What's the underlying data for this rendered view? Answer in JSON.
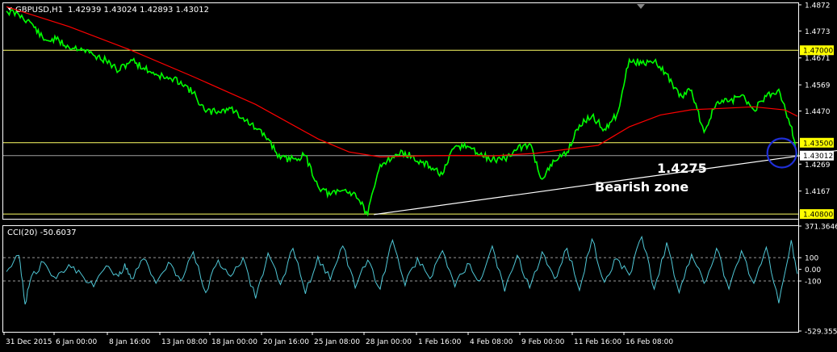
{
  "header": {
    "symbol": "GBPUSD,H1",
    "ohlc": "1.42939 1.43024 1.42893 1.43012"
  },
  "annotations": {
    "price_label": "1.4275",
    "zone_label": "Bearish zone"
  },
  "colors": {
    "background": "#000000",
    "price": "#00ff00",
    "ma": "#ff0000",
    "level_line": "#ffff66",
    "trendline": "#ffffff",
    "cci": "#4fc7d6",
    "circle": "#1f2fd8",
    "label_bg": "#ffff00"
  },
  "chart_data": [
    {
      "type": "line",
      "title": "GBPUSD,H1 1.42939 1.43024 1.42893 1.43012",
      "xlabel": "",
      "ylabel": "",
      "ylim": [
        1.4062,
        1.4878
      ],
      "x_ticks": [
        "31 Dec 2015",
        "6 Jan 00:00",
        "8 Jan 16:00",
        "13 Jan 08:00",
        "18 Jan 00:00",
        "20 Jan 16:00",
        "25 Jan 08:00",
        "28 Jan 00:00",
        "1 Feb 16:00",
        "4 Feb 08:00",
        "9 Feb 00:00",
        "11 Feb 16:00",
        "16 Feb 08:00"
      ],
      "y_ticks": [
        1.4872,
        1.4773,
        1.4671,
        1.4569,
        1.447,
        1.4269,
        1.4167
      ],
      "series": [
        {
          "name": "",
          "kind": "price",
          "color": "#00ff00",
          "x": [
            0,
            2,
            4,
            6,
            8,
            10,
            12,
            14,
            16,
            18,
            20,
            22,
            24,
            26,
            28,
            30,
            32,
            34,
            36,
            38,
            40,
            42,
            44,
            46,
            48,
            50,
            52,
            54,
            56,
            58,
            60,
            62,
            64,
            66,
            68,
            70,
            72,
            74,
            76,
            78,
            80,
            82,
            84,
            86,
            88,
            90,
            92,
            94,
            96,
            98,
            100,
            102,
            104,
            106,
            108,
            110,
            112,
            114,
            116,
            118,
            120,
            122,
            124,
            126,
            127
          ],
          "values": [
            1.4848,
            1.4835,
            1.4803,
            1.4738,
            1.4741,
            1.4712,
            1.4708,
            1.4681,
            1.4661,
            1.4621,
            1.4664,
            1.4633,
            1.461,
            1.4591,
            1.4582,
            1.4538,
            1.4466,
            1.4469,
            1.448,
            1.4444,
            1.4404,
            1.4365,
            1.4289,
            1.429,
            1.4301,
            1.4186,
            1.4152,
            1.417,
            1.4158,
            1.4078,
            1.4267,
            1.4298,
            1.4314,
            1.4279,
            1.426,
            1.423,
            1.4335,
            1.4337,
            1.4305,
            1.4286,
            1.429,
            1.4325,
            1.4346,
            1.4212,
            1.428,
            1.4315,
            1.4417,
            1.445,
            1.4402,
            1.4455,
            1.4665,
            1.465,
            1.4658,
            1.4611,
            1.4525,
            1.4549,
            1.439,
            1.4501,
            1.4506,
            1.453,
            1.4474,
            1.4525,
            1.4552,
            1.4412,
            1.4303
          ]
        },
        {
          "name": "",
          "kind": "ma",
          "color": "#ff0000",
          "x": [
            0,
            10,
            20,
            30,
            40,
            50,
            55,
            60,
            66,
            72,
            78,
            85,
            90,
            95,
            100,
            105,
            110,
            115,
            120,
            125,
            127
          ],
          "values": [
            1.4865,
            1.479,
            1.47,
            1.46,
            1.4495,
            1.4365,
            1.4315,
            1.4296,
            1.43,
            1.4302,
            1.43,
            1.431,
            1.4325,
            1.434,
            1.441,
            1.4455,
            1.4475,
            1.448,
            1.4486,
            1.4474,
            1.445
          ]
        }
      ],
      "horizontal_levels": [
        1.47,
        1.435,
        1.408
      ],
      "level_labels": [
        "1.47000",
        "1.43500",
        "1.40800"
      ],
      "current_price": 1.43012,
      "current_label": "1.43012",
      "trendline": {
        "from": {
          "x": 59,
          "y": 1.4078
        },
        "to": {
          "x": 141,
          "y": 1.4345
        }
      },
      "circle": {
        "x": 124.5,
        "y": 1.4311
      },
      "legend": "none",
      "grid": false
    },
    {
      "type": "line",
      "title": "CCI(20) -50.6037",
      "ylim": [
        -529.3555,
        371.3646
      ],
      "y_ticks": [
        371.3646,
        100,
        0,
        -100,
        -529.3555
      ],
      "y_tick_labels": [
        "371.3646",
        "100",
        "0.00",
        "-100",
        "-529.3555"
      ],
      "levels": [
        100,
        -100
      ],
      "series": [
        {
          "name": "",
          "color": "#4fc7d6",
          "x": [
            0,
            2,
            3,
            4,
            6,
            8,
            10,
            12,
            14,
            16,
            18,
            19,
            20,
            22,
            24,
            26,
            28,
            30,
            32,
            34,
            36,
            38,
            40,
            42,
            44,
            46,
            48,
            50,
            52,
            54,
            56,
            58,
            60,
            62,
            64,
            66,
            68,
            70,
            72,
            74,
            76,
            78,
            80,
            82,
            84,
            86,
            88,
            90,
            92,
            94,
            96,
            98,
            100,
            102,
            104,
            106,
            108,
            110,
            112,
            114,
            116,
            118,
            120,
            122,
            124,
            126,
            127
          ],
          "values": [
            -20,
            120,
            -300,
            -60,
            60,
            -80,
            40,
            -40,
            -150,
            30,
            -60,
            50,
            -80,
            90,
            -120,
            60,
            -100,
            150,
            -200,
            80,
            -60,
            100,
            -250,
            140,
            -130,
            180,
            -210,
            110,
            -90,
            200,
            -160,
            80,
            -170,
            250,
            -140,
            100,
            -80,
            160,
            -150,
            50,
            -100,
            200,
            -190,
            120,
            -160,
            150,
            -80,
            180,
            -180,
            260,
            -110,
            90,
            -50,
            280,
            -170,
            230,
            -200,
            130,
            -120,
            180,
            -170,
            160,
            -120,
            190,
            -290,
            250,
            -40
          ]
        }
      ],
      "legend": "none",
      "grid": false
    }
  ]
}
